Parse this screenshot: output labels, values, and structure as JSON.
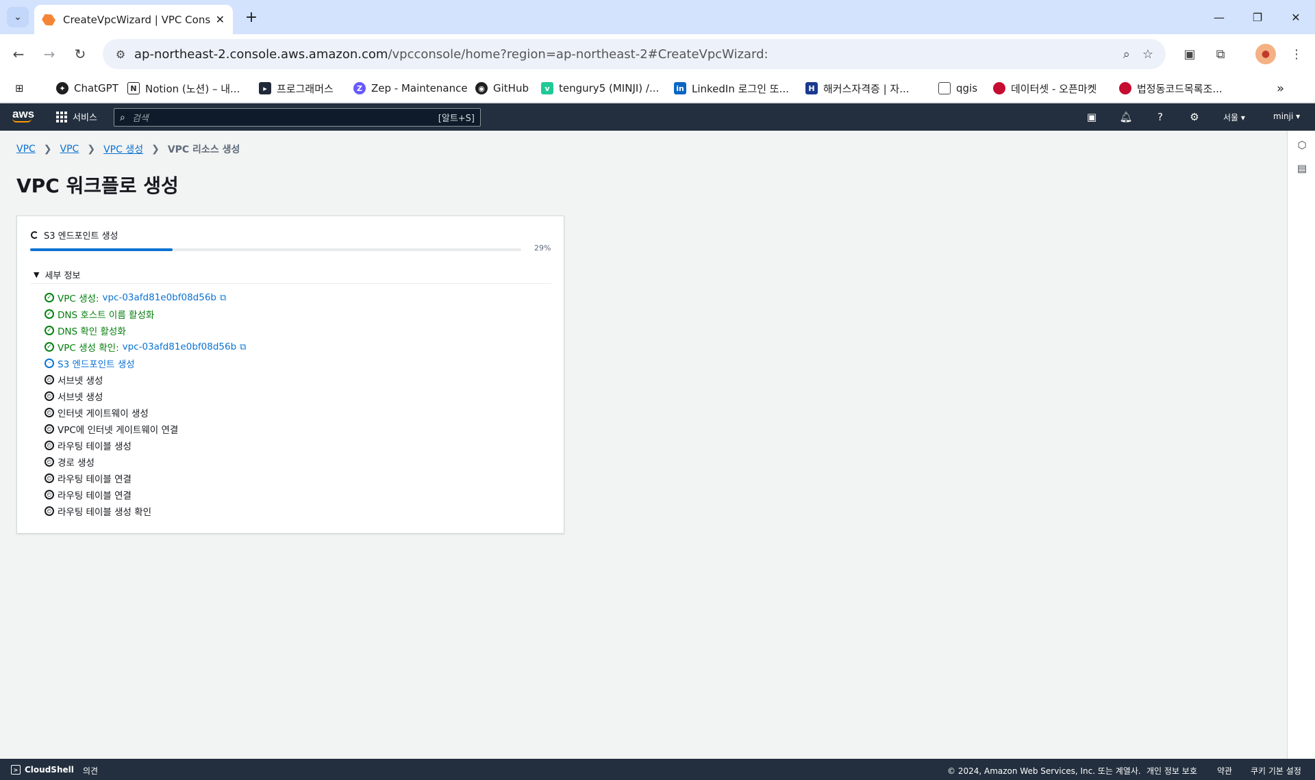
{
  "browser": {
    "tab_title": "CreateVpcWizard | VPC Console",
    "tab_close": "✕",
    "new_tab": "+",
    "url_host": "ap-northeast-2.console.aws.amazon.com",
    "url_path": "/vpcconsole/home?region=ap-northeast-2#CreateVpcWizard:",
    "bookmarks": [
      {
        "label": "ChatGPT",
        "icon": "chatgpt-icon",
        "color": "#1f1f1f"
      },
      {
        "label": "Notion (노션) – 내...",
        "icon": "notion-icon",
        "color": "#1f1f1f"
      },
      {
        "label": "프로그래머스",
        "icon": "programmers-icon",
        "color": "#1f2937"
      },
      {
        "label": "Zep - Maintenance",
        "icon": "zep-icon",
        "color": "#6758ff"
      },
      {
        "label": "GitHub",
        "icon": "github-icon",
        "color": "#1f1f1f"
      },
      {
        "label": "tengury5 (MINJI) /...",
        "icon": "velog-icon",
        "color": "#20c997"
      },
      {
        "label": "LinkedIn 로그인 또...",
        "icon": "linkedin-icon",
        "color": "#0a66c2"
      },
      {
        "label": "해커스자격증 | 자...",
        "icon": "hackers-icon",
        "color": "#1a3a8f"
      },
      {
        "label": "qgis",
        "icon": "folder-icon",
        "color": "#444"
      },
      {
        "label": "데이터셋 - 오픈마켓",
        "icon": "korea-gov-icon",
        "color": "#c60c30"
      },
      {
        "label": "법정동코드목록조...",
        "icon": "korea-gov-icon",
        "color": "#c60c30"
      }
    ],
    "bookmarks_more": "»"
  },
  "aws_nav": {
    "logo": "aws",
    "services_label": "서비스",
    "search_placeholder": "검색",
    "search_shortcut": "[알트+S]",
    "region": "서울 ▾",
    "user": "minji ▾"
  },
  "breadcrumb": [
    {
      "label": "VPC",
      "link": true
    },
    {
      "label": "VPC",
      "link": true
    },
    {
      "label": "VPC 생성",
      "link": true
    },
    {
      "label": "VPC 리소스 생성",
      "link": false
    }
  ],
  "page_title": "VPC 워크플로 생성",
  "progress": {
    "status_label": "S3 엔드포인트 생성",
    "percent": 29,
    "percent_label": "29%"
  },
  "details": {
    "heading": "세부 정보",
    "steps": [
      {
        "label": "VPC 생성:",
        "resource": "vpc-03afd81e0bf08d56b",
        "state": "done",
        "external": true
      },
      {
        "label": "DNS 호스트 이름 활성화",
        "state": "done"
      },
      {
        "label": "DNS 확인 활성화",
        "state": "done"
      },
      {
        "label": "VPC 생성 확인:",
        "resource": "vpc-03afd81e0bf08d56b",
        "state": "done",
        "external": true
      },
      {
        "label": "S3 엔드포인트 생성",
        "state": "active"
      },
      {
        "label": "서브넷 생성",
        "state": "pending"
      },
      {
        "label": "서브넷 생성",
        "state": "pending"
      },
      {
        "label": "인터넷 게이트웨이 생성",
        "state": "pending"
      },
      {
        "label": "VPC에 인터넷 게이트웨이 연결",
        "state": "pending"
      },
      {
        "label": "라우팅 테이블 생성",
        "state": "pending"
      },
      {
        "label": "경로 생성",
        "state": "pending"
      },
      {
        "label": "라우팅 테이블 연결",
        "state": "pending"
      },
      {
        "label": "라우팅 테이블 연결",
        "state": "pending"
      },
      {
        "label": "라우팅 테이블 생성 확인",
        "state": "pending"
      }
    ]
  },
  "footer": {
    "cloudshell": "CloudShell",
    "feedback": "의견",
    "copyright": "© 2024, Amazon Web Services, Inc. 또는 계열사.",
    "privacy": "개인 정보 보호",
    "terms": "약관",
    "cookies": "쿠키 기본 설정"
  },
  "colors": {
    "aws_nav": "#232f3e",
    "link": "#0972d3",
    "success": "#037f0c",
    "accent": "#ff9900"
  }
}
